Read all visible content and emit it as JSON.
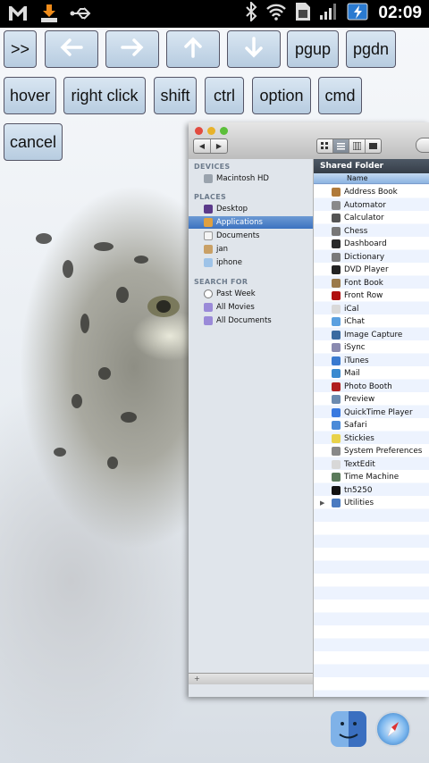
{
  "status_bar": {
    "time": "02:09",
    "icons": [
      "gmail-icon",
      "download-icon",
      "usb-icon",
      "bluetooth-icon",
      "wifi-icon",
      "sim-icon",
      "signal-icon",
      "battery-charging-icon"
    ]
  },
  "keyboard": {
    "row1": [
      ">>",
      "←",
      "→",
      "↑",
      "↓",
      "pgup",
      "pgdn"
    ],
    "row2": [
      "hover",
      "right click",
      "shift",
      "ctrl",
      "option",
      "cmd"
    ],
    "row3": [
      "cancel"
    ]
  },
  "finder": {
    "path_title": "Shared Folder",
    "column_header": "Name",
    "sidebar": {
      "devices_heading": "DEVICES",
      "devices": [
        "Macintosh HD"
      ],
      "places_heading": "PLACES",
      "places": [
        "Desktop",
        "Applications",
        "Documents",
        "jan",
        "iphone"
      ],
      "search_heading": "SEARCH FOR",
      "searches": [
        "Past Week",
        "All Movies",
        "All Documents"
      ],
      "selected": "Applications"
    },
    "files": [
      "Address Book",
      "Automator",
      "Calculator",
      "Chess",
      "Dashboard",
      "Dictionary",
      "DVD Player",
      "Font Book",
      "Front Row",
      "iCal",
      "iChat",
      "Image Capture",
      "iSync",
      "iTunes",
      "Mail",
      "Photo Booth",
      "Preview",
      "QuickTime Player",
      "Safari",
      "Stickies",
      "System Preferences",
      "TextEdit",
      "Time Machine",
      "tn5250",
      "Utilities"
    ],
    "file_colors": [
      "#b07a3a",
      "#8a8a8a",
      "#555555",
      "#777777",
      "#2a2a2a",
      "#7a7a7a",
      "#222222",
      "#9a7a4a",
      "#b01010",
      "#d9d9d9",
      "#5aa0e0",
      "#3a6aa0",
      "#8a8ab0",
      "#3a7ad0",
      "#3a8ad0",
      "#b02020",
      "#6a8ab0",
      "#3a7ae0",
      "#4a8ad8",
      "#e8d24a",
      "#888888",
      "#d8d8d8",
      "#5a7a5a",
      "#111111",
      "#4a7ac0"
    ]
  },
  "dock": {
    "icons": [
      "finder-icon",
      "safari-icon"
    ]
  }
}
